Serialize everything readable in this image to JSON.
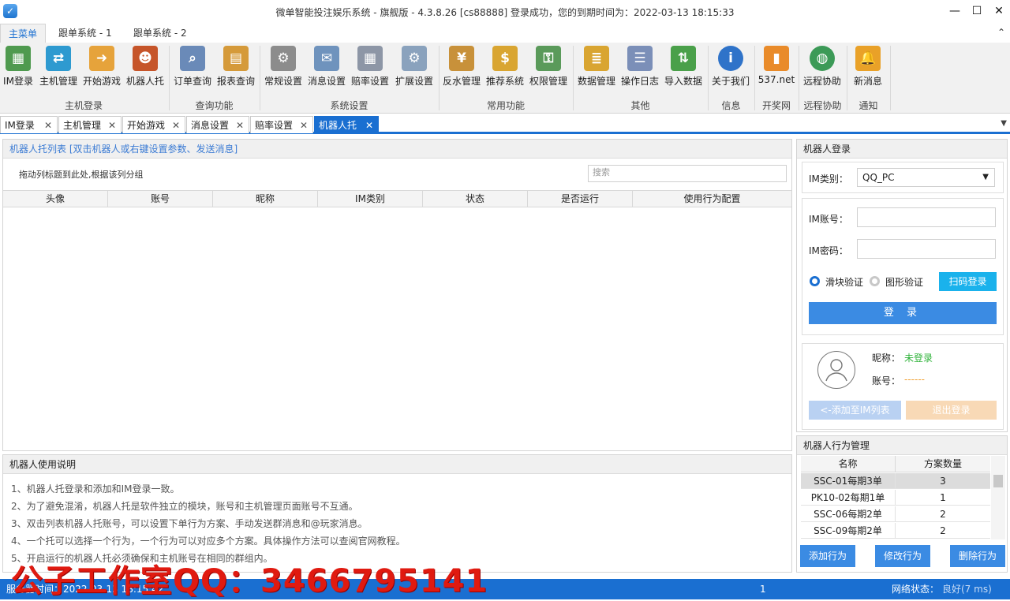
{
  "window": {
    "title": "微单智能投注娱乐系统 - 旗舰版 - 4.3.8.26    [cs88888] 登录成功，您的到期时间为：2022-03-13 18:15:33",
    "icon": "app-logo-icon",
    "minimize": "—",
    "maximize": "☐",
    "close": "✕"
  },
  "ribbon_tabs": [
    "主菜单",
    "跟单系统 - 1",
    "跟单系统 - 2"
  ],
  "ribbon_collapse": "⌃",
  "ribbon_buttons": [
    {
      "label": "IM登录",
      "icon": "im-login-icon"
    },
    {
      "label": "主机管理",
      "icon": "host-manage-icon"
    },
    {
      "label": "开始游戏",
      "icon": "start-game-icon"
    },
    {
      "label": "机器人托",
      "icon": "robot-icon"
    },
    {
      "label": "订单查询",
      "icon": "order-search-icon"
    },
    {
      "label": "报表查询",
      "icon": "report-search-icon"
    },
    {
      "label": "常规设置",
      "icon": "general-settings-icon"
    },
    {
      "label": "消息设置",
      "icon": "message-settings-icon"
    },
    {
      "label": "赔率设置",
      "icon": "odds-settings-icon"
    },
    {
      "label": "扩展设置",
      "icon": "extension-settings-icon"
    },
    {
      "label": "反水管理",
      "icon": "rebate-icon"
    },
    {
      "label": "推荐系统",
      "icon": "recommend-icon"
    },
    {
      "label": "权限管理",
      "icon": "permission-icon"
    },
    {
      "label": "数据管理",
      "icon": "database-icon"
    },
    {
      "label": "操作日志",
      "icon": "log-icon"
    },
    {
      "label": "导入数据",
      "icon": "import-icon"
    },
    {
      "label": "关于我们",
      "icon": "info-icon"
    },
    {
      "label": "537.net",
      "icon": "bar-chart-icon"
    },
    {
      "label": "远程协助",
      "icon": "globe-icon"
    },
    {
      "label": "新消息",
      "icon": "bell-icon"
    }
  ],
  "ribbon_groups": [
    "主机登录",
    "查询功能",
    "系统设置",
    "常用功能",
    "其他",
    "信息",
    "开奖网",
    "远程协助",
    "通知"
  ],
  "doc_tabs": [
    "IM登录",
    "主机管理",
    "开始游戏",
    "消息设置",
    "赔率设置",
    "机器人托"
  ],
  "robot_list": {
    "title": "机器人托列表 [双击机器人或右键设置参数、发送消息]",
    "group_hint": "拖动列标题到此处,根据该列分组",
    "search_placeholder": "搜索",
    "columns": [
      "头像",
      "账号",
      "昵称",
      "IM类别",
      "状态",
      "是否运行",
      "使用行为配置"
    ]
  },
  "notes": {
    "title": "机器人使用说明",
    "lines": [
      "1、机器人托登录和添加和IM登录一致。",
      "2、为了避免混淆，机器人托是软件独立的模块，账号和主机管理页面账号不互通。",
      "3、双击列表机器人托账号，可以设置下单行为方案、手动发送群消息和@玩家消息。",
      "4、一个托可以选择一个行为，一个行为可以对应多个方案。具体操作方法可以查阅官网教程。",
      "5、开启运行的机器人托必须确保和主机账号在相同的群组内。"
    ]
  },
  "robot_login": {
    "title": "机器人登录",
    "im_type_label": "IM类别：",
    "im_type_value": "QQ_PC",
    "account_label": "IM账号：",
    "password_label": "IM密码：",
    "slider_verify": "滑块验证",
    "image_verify": "图形验证",
    "scan_login": "扫码登录",
    "login": "登 录",
    "nickname_label": "昵称：",
    "nickname_value": "未登录",
    "account_label2": "账号：",
    "account_value": "------",
    "add_to_im": "<-添加至IM列表",
    "logout": "退出登录",
    "green": "#2fb33a",
    "orange": "#f0a030"
  },
  "behavior": {
    "title": "机器人行为管理",
    "columns": [
      "名称",
      "方案数量"
    ],
    "rows": [
      {
        "name": "SSC-01每期3单",
        "count": "3"
      },
      {
        "name": "PK10-02每期1单",
        "count": "1"
      },
      {
        "name": "SSC-06每期2单",
        "count": "2"
      },
      {
        "name": "SSC-09每期2单",
        "count": "2"
      }
    ],
    "add": "添加行为",
    "edit": "修改行为",
    "delete": "删除行为"
  },
  "status_bar": {
    "server_time": "服务器时间：2022-03-13 18:15:42",
    "count": "1",
    "network_label": "网络状态：",
    "network_value": "良好(7 ms)"
  },
  "watermark": "公子工作室QQ：3466795141"
}
